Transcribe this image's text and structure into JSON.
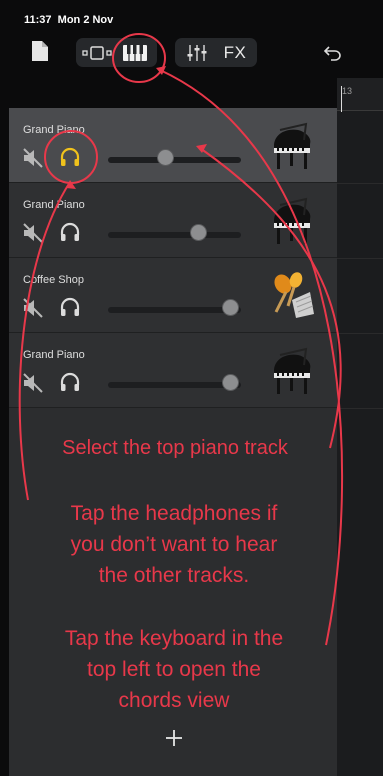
{
  "status": {
    "time": "11:37",
    "date": "Mon 2 Nov"
  },
  "toolbar": {
    "fx_label": "FX",
    "icons": [
      "new-song-icon",
      "tracks-view-icon",
      "keyboard-icon",
      "mixer-icon",
      "undo-icon"
    ]
  },
  "timeline": {
    "bar_number": "13"
  },
  "tracks": [
    {
      "name": "Grand Piano",
      "instrument": "grand-piano-icon",
      "volume": 0.45,
      "selected": true,
      "headphones_active": true
    },
    {
      "name": "Grand Piano",
      "instrument": "grand-piano-icon",
      "volume": 0.7,
      "selected": false,
      "headphones_active": false
    },
    {
      "name": "Coffee Shop",
      "instrument": "maracas-icon",
      "volume": 0.95,
      "selected": false,
      "headphones_active": false
    },
    {
      "name": "Grand Piano",
      "instrument": "grand-piano-icon",
      "volume": 0.95,
      "selected": false,
      "headphones_active": false
    }
  ],
  "annotations": {
    "select_track": "Select the top piano track",
    "headphones_line1": "Tap the headphones if",
    "headphones_line2": "you don’t want to hear",
    "headphones_line3": "the other tracks.",
    "keyboard_line1": "Tap the keyboard in the",
    "keyboard_line2": "top left to open the",
    "keyboard_line3": "chords view"
  },
  "colors": {
    "annotation": "#e8384a",
    "headphones_active": "#f0c21c",
    "selected_track": "#4a4b4e"
  }
}
